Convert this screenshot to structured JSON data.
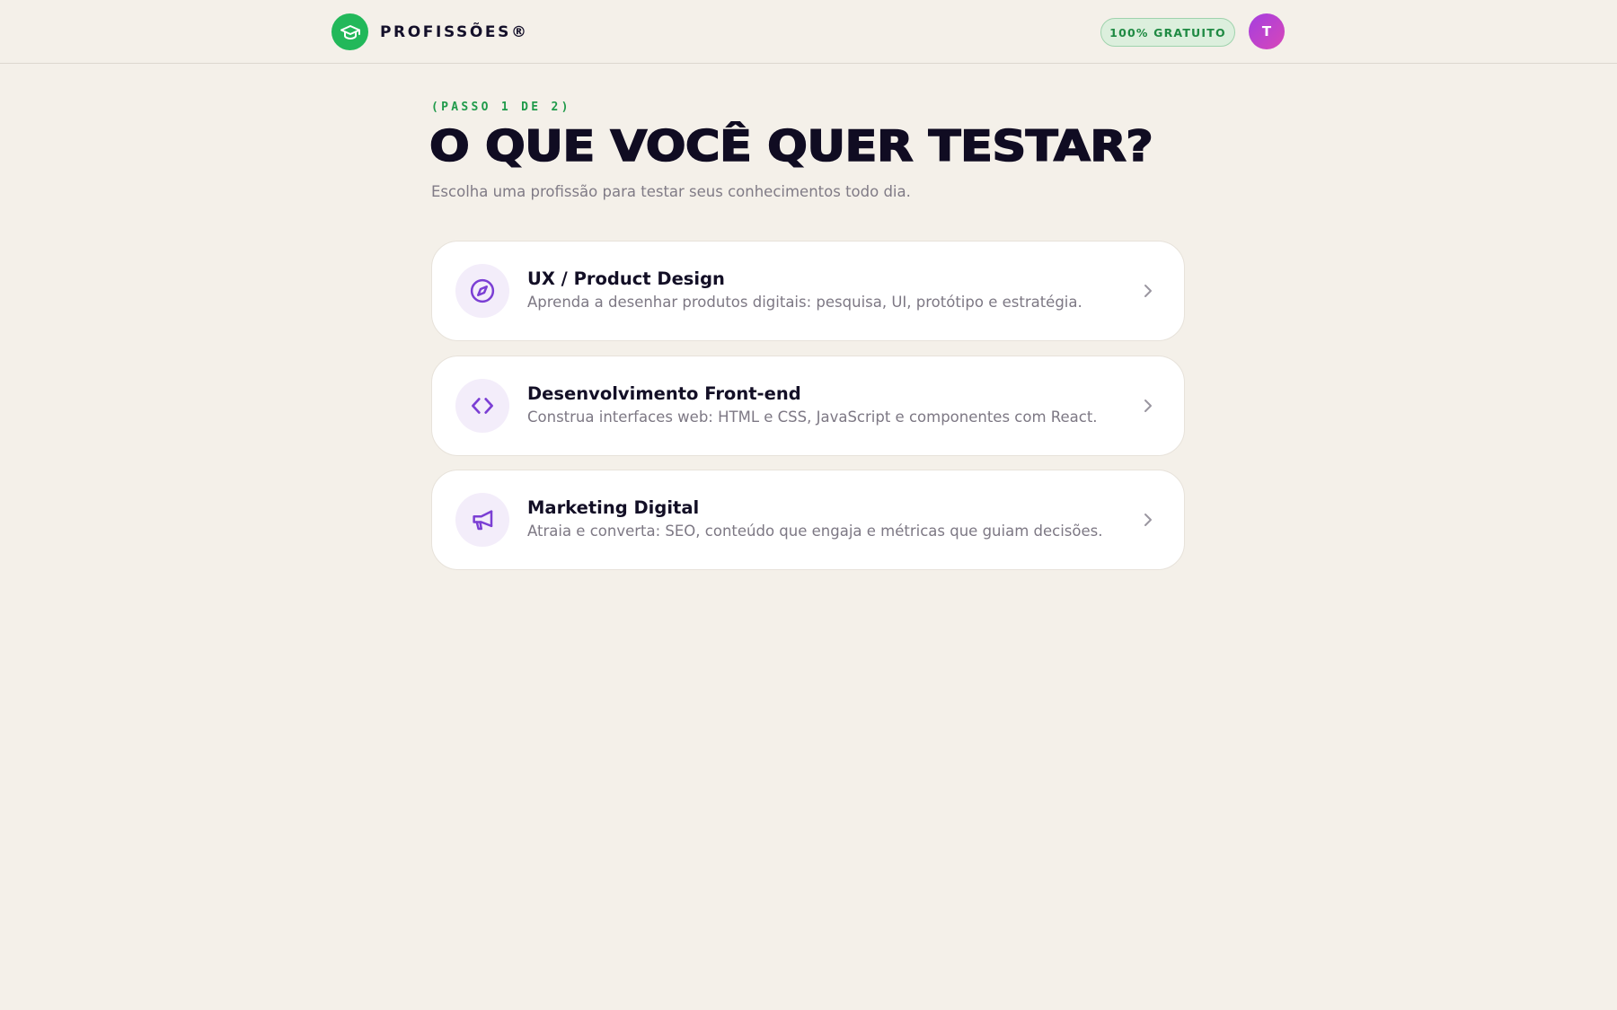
{
  "header": {
    "brand": "PROFISSÕES®",
    "badge": "100% GRATUITO",
    "avatar_initial": "T"
  },
  "main": {
    "step": "(PASSO 1 DE 2)",
    "title": "O QUE VOCÊ QUER TESTAR?",
    "subtitle": "Escolha uma profissão para testar seus conhecimentos todo dia."
  },
  "options": [
    {
      "icon": "compass-icon",
      "title": "UX / Product Design",
      "description": "Aprenda a desenhar produtos digitais: pesquisa, UI, protótipo e estratégia."
    },
    {
      "icon": "code-icon",
      "title": "Desenvolvimento Front-end",
      "description": "Construa interfaces web: HTML e CSS, JavaScript e componentes com React."
    },
    {
      "icon": "megaphone-icon",
      "title": "Marketing Digital",
      "description": "Atraia e converta: SEO, conteúdo que engaja e métricas que guiam decisões."
    }
  ],
  "colors": {
    "background": "#f4f0e9",
    "brand_green": "#22b85a",
    "accent_purple": "#7b3fd4",
    "card_background": "#ffffff"
  }
}
